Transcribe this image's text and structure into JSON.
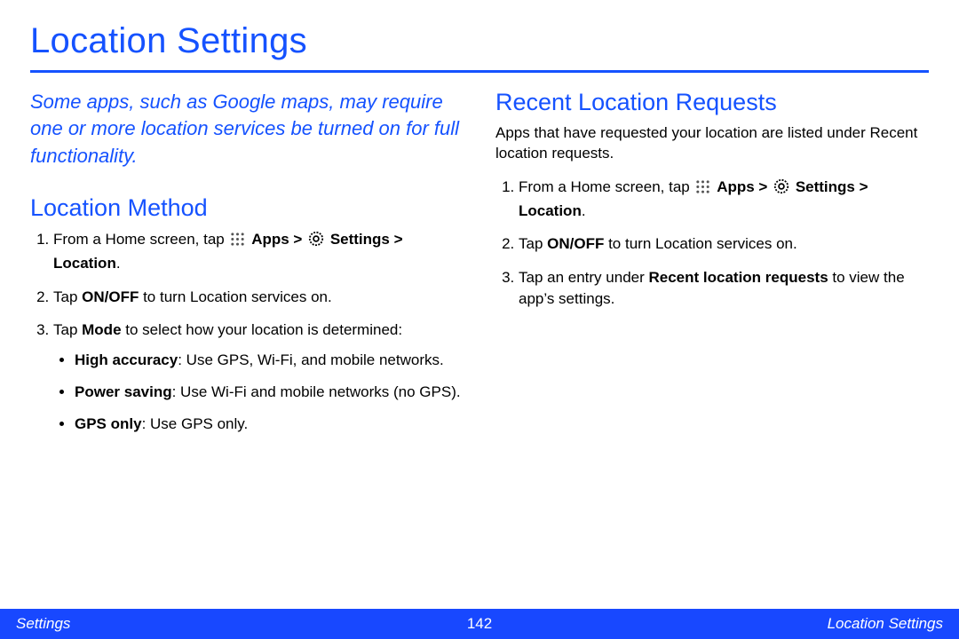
{
  "page": {
    "title": "Location Settings",
    "intro": "Some apps, such as Google maps, may require one or more location services be turned on for full functionality."
  },
  "left": {
    "heading": "Location Method",
    "step1_a": "From a Home screen, tap ",
    "step1_apps": "Apps > ",
    "step1_settings": "Settings > Location",
    "step1_end": ".",
    "step2_a": "Tap ",
    "step2_b": "ON/OFF",
    "step2_c": " to turn Location services on.",
    "step3_a": "Tap ",
    "step3_b": "Mode",
    "step3_c": " to select how your location is determined:",
    "b1_a": "High accuracy",
    "b1_b": ": Use GPS, Wi-Fi, and mobile networks.",
    "b2_a": "Power saving",
    "b2_b": ": Use Wi-Fi and mobile networks (no GPS).",
    "b3_a": "GPS only",
    "b3_b": ": Use GPS only."
  },
  "right": {
    "heading": "Recent Location Requests",
    "para": "Apps that have requested your location are listed under Recent location requests.",
    "step1_a": "From a Home screen, tap ",
    "step1_apps": "Apps > ",
    "step1_settings": "Settings > Location",
    "step1_end": ".",
    "step2_a": "Tap ",
    "step2_b": "ON/OFF",
    "step2_c": " to turn Location services on.",
    "step3_a": "Tap an entry under ",
    "step3_b": "Recent location requests",
    "step3_c": " to view the app’s settings."
  },
  "footer": {
    "left": "Settings",
    "page": "142",
    "right": "Location Settings"
  }
}
